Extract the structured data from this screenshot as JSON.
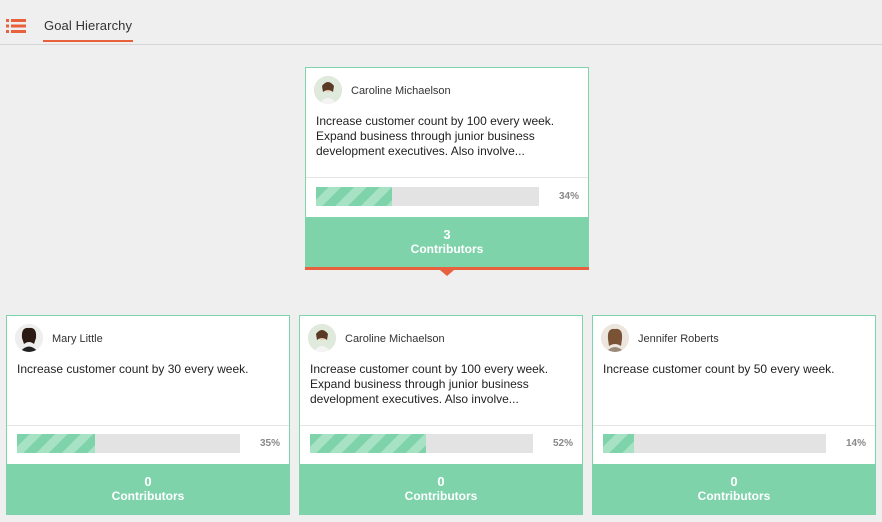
{
  "header": {
    "tab_label": "Goal Hierarchy",
    "menu_icon": "list-icon",
    "accent_color": "#e8603c"
  },
  "root_goal": {
    "owner": "Caroline Michaelson",
    "description": "Increase customer count by 100 every week. Expand business through junior business development executives. Also involve...",
    "progress_label": "34%",
    "progress": 0.34,
    "contributors_count": "3",
    "contributors_label": "Contributors"
  },
  "child_goals": [
    {
      "owner": "Mary Little",
      "description": "Increase customer count by 30 every week.",
      "progress_label": "35%",
      "progress": 0.35,
      "contributors_count": "0",
      "contributors_label": "Contributors"
    },
    {
      "owner": "Caroline Michaelson",
      "description": "Increase customer count by 100 every week. Expand business through junior business development executives. Also involve...",
      "progress_label": "52%",
      "progress": 0.52,
      "contributors_count": "0",
      "contributors_label": "Contributors"
    },
    {
      "owner": "Jennifer Roberts",
      "description": "Increase customer count by 50 every week.",
      "progress_label": "14%",
      "progress": 0.14,
      "contributors_count": "0",
      "contributors_label": "Contributors"
    }
  ],
  "colors": {
    "card_border": "#7fd3ab",
    "contributors_bg": "#7fd3ab",
    "progress_fill": "#7fd3ab",
    "progress_track": "#e3e3e3"
  }
}
